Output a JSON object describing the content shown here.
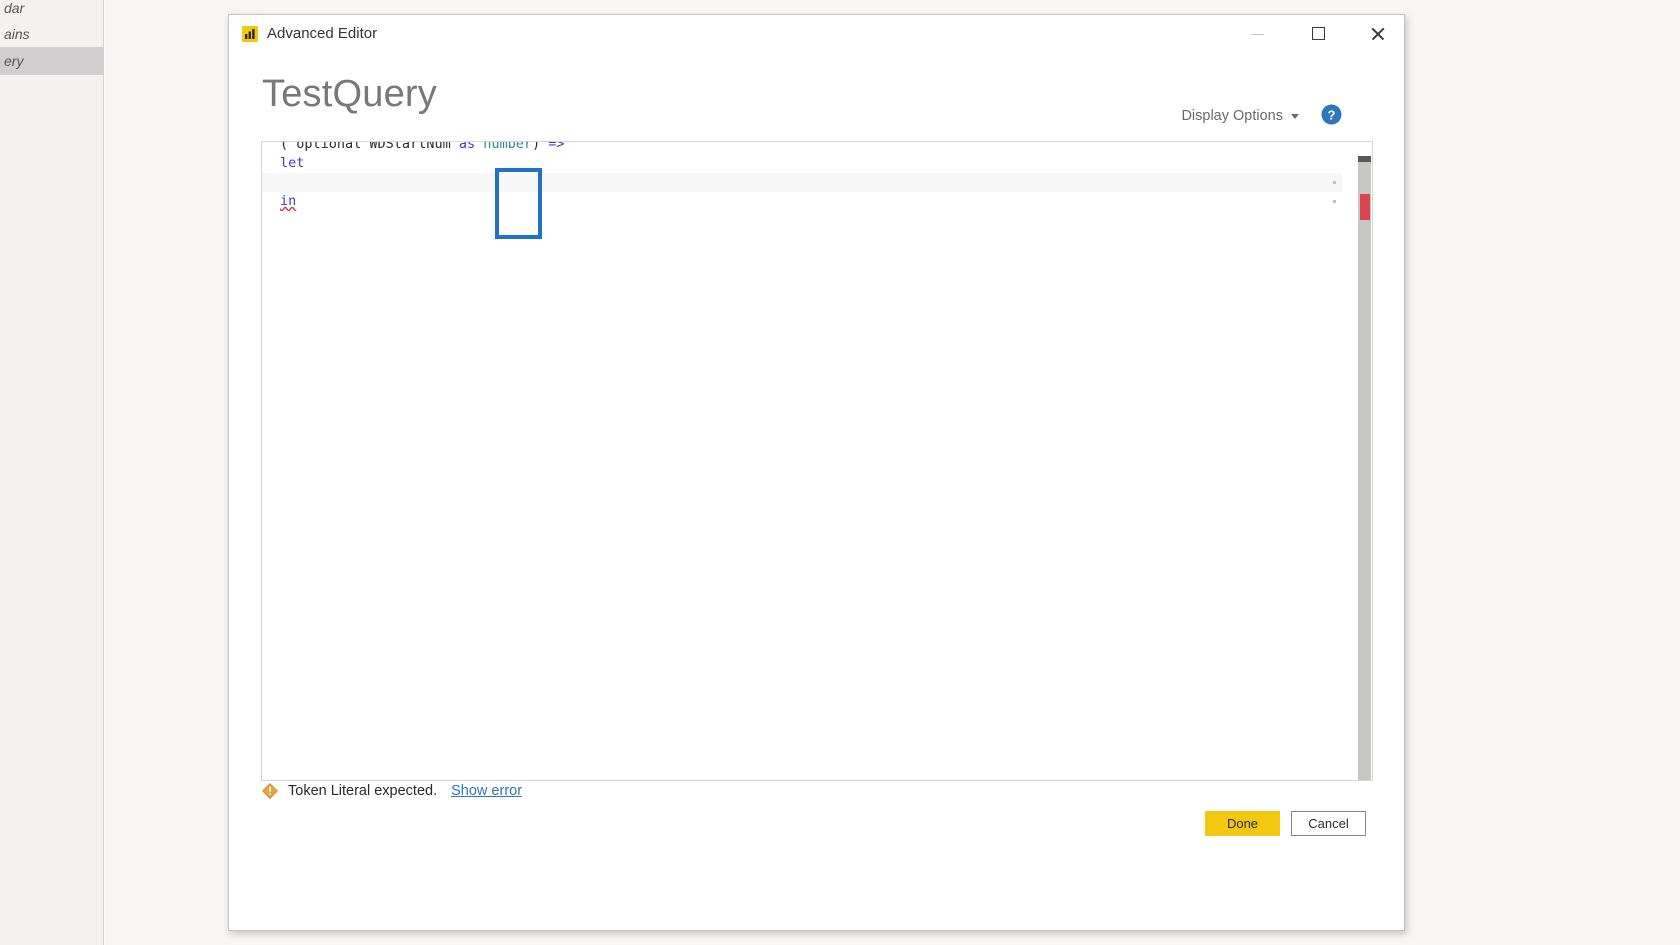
{
  "background": {
    "query_list": [
      {
        "label": "dar",
        "selected": false
      },
      {
        "label": "ains",
        "selected": false
      },
      {
        "label": "ery",
        "selected": true
      }
    ]
  },
  "dialog": {
    "titlebar": {
      "icon": "power-bi-icon",
      "title": "Advanced Editor",
      "minimize_label": "Minimize",
      "maximize_label": "Maximize",
      "close_label": "Close"
    },
    "query_name": "TestQuery",
    "display_options": {
      "label": "Display Options",
      "caret_icon": "chevron-down-icon"
    },
    "help": {
      "icon": "help-circle-icon",
      "color": "#2f77bb"
    },
    "editor": {
      "lines": [
        {
          "tokens": [
            {
              "text": "( ",
              "type": "punct"
            },
            {
              "text": "optional",
              "type": "plain"
            },
            {
              "text": " WDStartNum ",
              "type": "plain"
            },
            {
              "text": "as",
              "type": "keyword"
            },
            {
              "text": " ",
              "type": "plain"
            },
            {
              "text": "number",
              "type": "type"
            },
            {
              "text": ") ",
              "type": "punct"
            },
            {
              "text": "=>",
              "type": "operator"
            }
          ],
          "alt": false,
          "fold_dot": false
        },
        {
          "tokens": [
            {
              "text": "let",
              "type": "keyword"
            }
          ],
          "alt": false,
          "fold_dot": false
        },
        {
          "tokens": [
            {
              "text": "",
              "type": "plain"
            }
          ],
          "alt": true,
          "fold_dot": true
        },
        {
          "tokens": [
            {
              "text": "in",
              "type": "keyword-squiggle"
            }
          ],
          "alt": false,
          "fold_dot": true
        }
      ],
      "scrollbar": {
        "track_color": "#c8c6c4",
        "thumb_color": "#5a5856",
        "error_marker_color": "#d9444f"
      },
      "annotation_box_color": "#1f72c4"
    },
    "status": {
      "warning_icon": "warning-diamond-icon",
      "message": "Token Literal expected.",
      "link_label": "Show error",
      "link_color": "#2f77bb"
    },
    "footer": {
      "done_label": "Done",
      "done_color": "#f2c811",
      "cancel_label": "Cancel"
    }
  }
}
